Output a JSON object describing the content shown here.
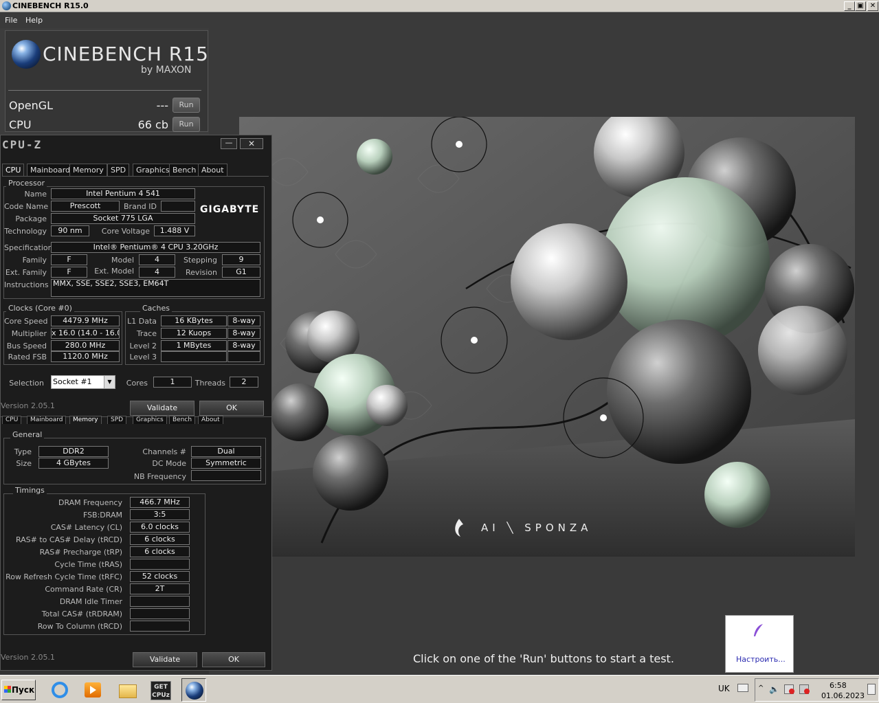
{
  "cinebench": {
    "title": "CINEBENCH R15.0",
    "menu": [
      "File",
      "Help"
    ],
    "logo_title": "CINEBENCH R15",
    "logo_by": "by MAXON",
    "rows": [
      {
        "label": "OpenGL",
        "value": "---",
        "button": "Run"
      },
      {
        "label": "CPU",
        "value": "66 cb",
        "button": "Run"
      }
    ],
    "render_watermark": "AI ╲ SPONZA",
    "message": "Click on one of the 'Run' buttons to start a test."
  },
  "cpuz_cpu": {
    "title": "CPU-Z",
    "tabs": [
      "CPU",
      "Mainboard",
      "Memory",
      "SPD",
      "Graphics",
      "Bench",
      "About"
    ],
    "processor": {
      "group": "Processor",
      "name_label": "Name",
      "name": "Intel Pentium 4 541",
      "codename_label": "Code Name",
      "codename": "Prescott",
      "brandid_label": "Brand ID",
      "brandid": "",
      "package_label": "Package",
      "package": "Socket 775 LGA",
      "technology_label": "Technology",
      "technology": "90 nm",
      "corevoltage_label": "Core Voltage",
      "corevoltage": "1.488 V",
      "vendor_logo": "GIGABYTE",
      "spec_label": "Specification",
      "spec": "Intel® Pentium® 4 CPU 3.20GHz",
      "family_label": "Family",
      "family": "F",
      "model_label": "Model",
      "model": "4",
      "stepping_label": "Stepping",
      "stepping": "9",
      "extfamily_label": "Ext. Family",
      "extfamily": "F",
      "extmodel_label": "Ext. Model",
      "extmodel": "4",
      "revision_label": "Revision",
      "revision": "G1",
      "instructions_label": "Instructions",
      "instructions": "MMX, SSE, SSE2, SSE3, EM64T"
    },
    "clocks": {
      "group": "Clocks (Core #0)",
      "corespeed_label": "Core Speed",
      "corespeed": "4479.9 MHz",
      "multiplier_label": "Multiplier",
      "multiplier": "x 16.0 (14.0 - 16.0)",
      "busspeed_label": "Bus Speed",
      "busspeed": "280.0 MHz",
      "ratedfsb_label": "Rated FSB",
      "ratedfsb": "1120.0 MHz"
    },
    "caches": {
      "group": "Caches",
      "rows": [
        {
          "label": "L1 Data",
          "size": "16 KBytes",
          "way": "8-way"
        },
        {
          "label": "Trace",
          "size": "12 Kuops",
          "way": "8-way"
        },
        {
          "label": "Level 2",
          "size": "1 MBytes",
          "way": "8-way"
        },
        {
          "label": "Level 3",
          "size": "",
          "way": ""
        }
      ]
    },
    "selection_label": "Selection",
    "selection": "Socket #1",
    "cores_label": "Cores",
    "cores": "1",
    "threads_label": "Threads",
    "threads": "2",
    "version": "Version 2.05.1",
    "validate": "Validate",
    "ok": "OK"
  },
  "cpuz_mem": {
    "tabs": [
      "CPU",
      "Mainboard",
      "Memory",
      "SPD",
      "Graphics",
      "Bench",
      "About"
    ],
    "general": {
      "group": "General",
      "type_label": "Type",
      "type": "DDR2",
      "size_label": "Size",
      "size": "4 GBytes",
      "channels_label": "Channels #",
      "channels": "Dual",
      "dcmode_label": "DC Mode",
      "dcmode": "Symmetric",
      "nbfreq_label": "NB Frequency",
      "nbfreq": ""
    },
    "timings": {
      "group": "Timings",
      "rows": [
        {
          "label": "DRAM Frequency",
          "value": "466.7 MHz"
        },
        {
          "label": "FSB:DRAM",
          "value": "3:5"
        },
        {
          "label": "CAS# Latency (CL)",
          "value": "6.0 clocks"
        },
        {
          "label": "RAS# to CAS# Delay (tRCD)",
          "value": "6 clocks"
        },
        {
          "label": "RAS# Precharge (tRP)",
          "value": "6 clocks"
        },
        {
          "label": "Cycle Time (tRAS)",
          "value": ""
        },
        {
          "label": "Row Refresh Cycle Time (tRFC)",
          "value": "52 clocks"
        },
        {
          "label": "Command Rate (CR)",
          "value": "2T"
        },
        {
          "label": "DRAM Idle Timer",
          "value": ""
        },
        {
          "label": "Total CAS# (tRDRAM)",
          "value": ""
        },
        {
          "label": "Row To Column (tRCD)",
          "value": ""
        }
      ]
    },
    "version": "Version 2.05.1",
    "validate": "Validate",
    "ok": "OK"
  },
  "taskbar": {
    "start": "Пуск",
    "lang": "UK",
    "time": "6:58",
    "date": "01.06.2023",
    "notif_link": "Настроить..."
  }
}
